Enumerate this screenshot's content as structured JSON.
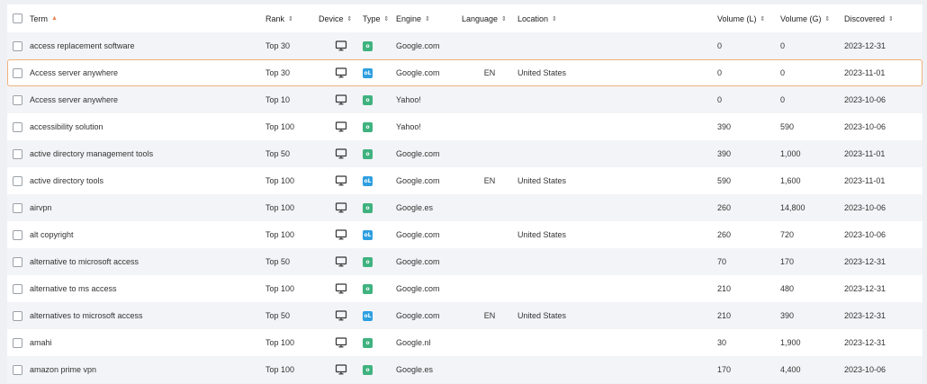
{
  "colors": {
    "organic": "#3fb27f",
    "local": "#2e9fe0",
    "accent": "#e8834e",
    "selected_border": "#f0b27a"
  },
  "headers": {
    "term": "Term",
    "rank": "Rank",
    "device": "Device",
    "type": "Type",
    "engine": "Engine",
    "language": "Language",
    "location": "Location",
    "volume_l": "Volume (L)",
    "volume_g": "Volume (G)",
    "discovered": "Discovered"
  },
  "rows": [
    {
      "term": "access replacement software",
      "rank": "Top 30",
      "device": "desktop-icon",
      "type": "organic",
      "type_glyph": "o",
      "engine": "Google.com",
      "language": "",
      "location": "",
      "volume_l": "0",
      "volume_g": "0",
      "discovered": "2023-12-31"
    },
    {
      "term": "Access server anywhere",
      "rank": "Top 30",
      "device": "desktop-icon",
      "type": "local",
      "type_glyph": "oL",
      "engine": "Google.com",
      "language": "EN",
      "location": "United States",
      "volume_l": "0",
      "volume_g": "0",
      "discovered": "2023-11-01"
    },
    {
      "term": "Access server anywhere",
      "rank": "Top 10",
      "device": "desktop-icon",
      "type": "organic",
      "type_glyph": "o",
      "engine": "Yahoo!",
      "language": "",
      "location": "",
      "volume_l": "0",
      "volume_g": "0",
      "discovered": "2023-10-06"
    },
    {
      "term": "accessibility solution",
      "rank": "Top 100",
      "device": "desktop-icon",
      "type": "organic",
      "type_glyph": "o",
      "engine": "Yahoo!",
      "language": "",
      "location": "",
      "volume_l": "390",
      "volume_g": "590",
      "discovered": "2023-10-06"
    },
    {
      "term": "active directory management tools",
      "rank": "Top 50",
      "device": "desktop-icon",
      "type": "organic",
      "type_glyph": "o",
      "engine": "Google.com",
      "language": "",
      "location": "",
      "volume_l": "390",
      "volume_g": "1,000",
      "discovered": "2023-11-01"
    },
    {
      "term": "active directory tools",
      "rank": "Top 100",
      "device": "desktop-icon",
      "type": "local",
      "type_glyph": "oL",
      "engine": "Google.com",
      "language": "EN",
      "location": "United States",
      "volume_l": "590",
      "volume_g": "1,600",
      "discovered": "2023-11-01"
    },
    {
      "term": "airvpn",
      "rank": "Top 100",
      "device": "desktop-icon",
      "type": "organic",
      "type_glyph": "o",
      "engine": "Google.es",
      "language": "",
      "location": "",
      "volume_l": "260",
      "volume_g": "14,800",
      "discovered": "2023-10-06"
    },
    {
      "term": "alt copyright",
      "rank": "Top 100",
      "device": "desktop-icon",
      "type": "local",
      "type_glyph": "oL",
      "engine": "Google.com",
      "language": "",
      "location": "United States",
      "volume_l": "260",
      "volume_g": "720",
      "discovered": "2023-10-06"
    },
    {
      "term": "alternative to microsoft access",
      "rank": "Top 50",
      "device": "desktop-icon",
      "type": "organic",
      "type_glyph": "o",
      "engine": "Google.com",
      "language": "",
      "location": "",
      "volume_l": "70",
      "volume_g": "170",
      "discovered": "2023-12-31"
    },
    {
      "term": "alternative to ms access",
      "rank": "Top 100",
      "device": "desktop-icon",
      "type": "organic",
      "type_glyph": "o",
      "engine": "Google.com",
      "language": "",
      "location": "",
      "volume_l": "210",
      "volume_g": "480",
      "discovered": "2023-12-31"
    },
    {
      "term": "alternatives to microsoft access",
      "rank": "Top 50",
      "device": "desktop-icon",
      "type": "local",
      "type_glyph": "oL",
      "engine": "Google.com",
      "language": "EN",
      "location": "United States",
      "volume_l": "210",
      "volume_g": "390",
      "discovered": "2023-12-31"
    },
    {
      "term": "amahi",
      "rank": "Top 100",
      "device": "desktop-icon",
      "type": "organic",
      "type_glyph": "o",
      "engine": "Google.nl",
      "language": "",
      "location": "",
      "volume_l": "30",
      "volume_g": "1,900",
      "discovered": "2023-12-31"
    },
    {
      "term": "amazon prime vpn",
      "rank": "Top 100",
      "device": "desktop-icon",
      "type": "organic",
      "type_glyph": "o",
      "engine": "Google.es",
      "language": "",
      "location": "",
      "volume_l": "170",
      "volume_g": "4,400",
      "discovered": "2023-10-06"
    }
  ]
}
